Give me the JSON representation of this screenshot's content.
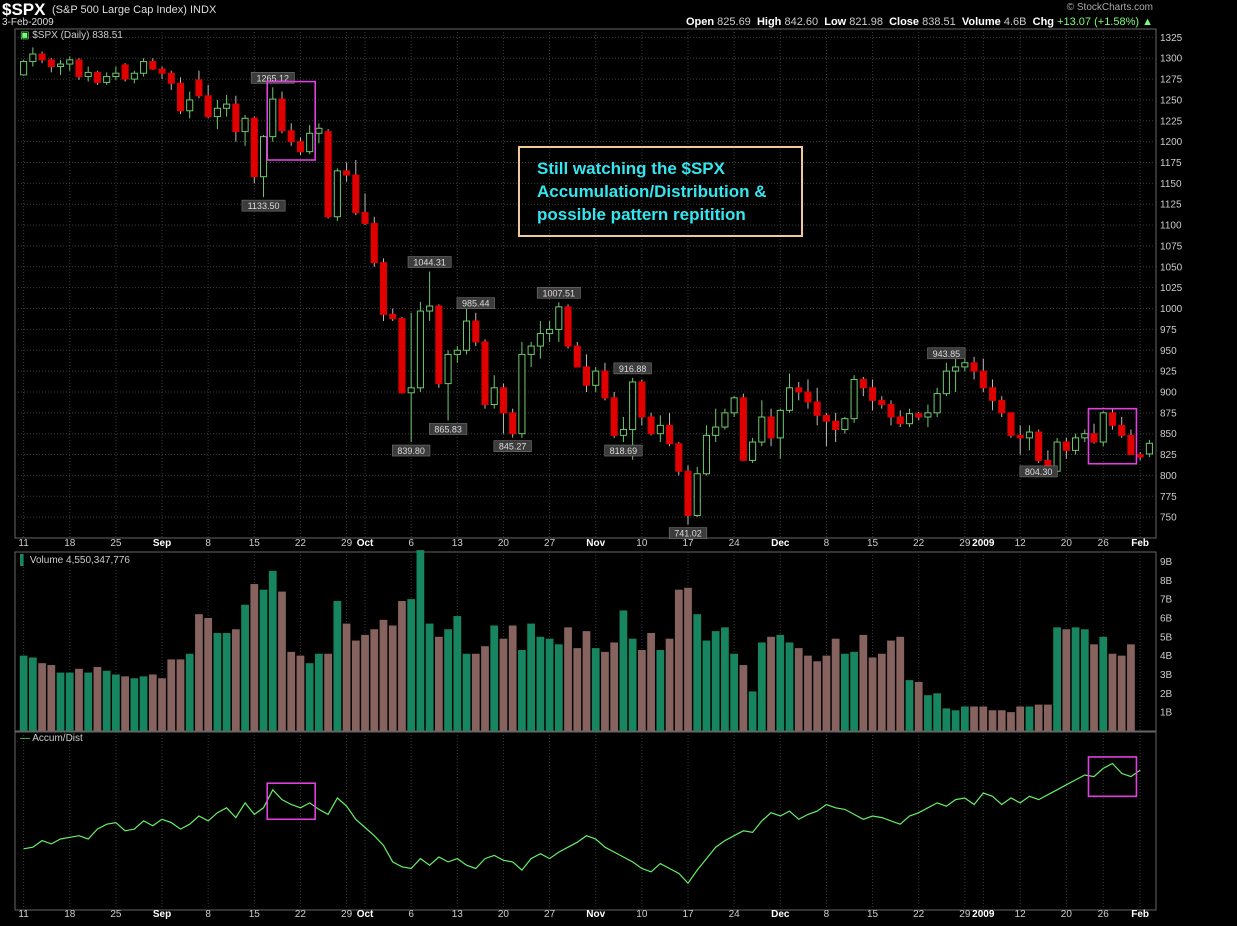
{
  "header": {
    "symbol": "$SPX",
    "name": "(S&P 500 Large Cap Index) INDX",
    "date": "3-Feb-2009",
    "brand": "© StockCharts.com",
    "open_label": "Open",
    "open": "825.69",
    "high_label": "High",
    "high": "842.60",
    "low_label": "Low",
    "low": "821.98",
    "close_label": "Close",
    "close": "838.51",
    "volume_label": "Volume",
    "volume": "4.6B",
    "chg_label": "Chg",
    "chg": "+13.07 (+1.58%)"
  },
  "price_label": "$SPX (Daily) 838.51",
  "volume_label": "Volume 4,550,347,776",
  "ad_label": "Accum/Dist",
  "annotation": "Still watching the $SPX\nAccumulation/Distribution &\npossible pattern repitition",
  "colors": {
    "up": "#6ec96e",
    "down": "#e00000",
    "vol_up": "#178560",
    "vol_down": "#87635f",
    "ad": "#66ee66",
    "box": "#e040e0",
    "note": "#33e6f0"
  },
  "chart_data": {
    "type": "candlestick",
    "price_axis": {
      "ticks": [
        750,
        775,
        800,
        825,
        850,
        875,
        900,
        925,
        950,
        975,
        1000,
        1025,
        1050,
        1075,
        1100,
        1125,
        1150,
        1175,
        1200,
        1225,
        1250,
        1275,
        1300,
        1325
      ],
      "range": [
        725,
        1335
      ]
    },
    "x_tick_labels": [
      "11",
      "18",
      "25",
      "Sep",
      "8",
      "15",
      "22",
      "29",
      "Oct",
      "6",
      "13",
      "20",
      "27",
      "Nov",
      "10",
      "17",
      "24",
      "Dec",
      "8",
      "15",
      "22",
      "29",
      "2009",
      "12",
      "20",
      "26",
      "Feb"
    ],
    "x_tick_index": [
      0,
      5,
      10,
      15,
      20,
      25,
      30,
      35,
      37,
      42,
      47,
      52,
      57,
      62,
      67,
      72,
      77,
      82,
      87,
      92,
      97,
      102,
      104,
      108,
      113,
      117,
      121
    ],
    "bold_ticks": [
      "Sep",
      "Oct",
      "Nov",
      "Dec",
      "2009",
      "Feb"
    ],
    "ohlc": [
      [
        1280,
        1298,
        1279,
        1296
      ],
      [
        1296,
        1313,
        1290,
        1305
      ],
      [
        1305,
        1308,
        1294,
        1298
      ],
      [
        1298,
        1300,
        1283,
        1290
      ],
      [
        1290,
        1298,
        1280,
        1293
      ],
      [
        1293,
        1302,
        1285,
        1298
      ],
      [
        1298,
        1300,
        1274,
        1278
      ],
      [
        1278,
        1290,
        1272,
        1283
      ],
      [
        1283,
        1285,
        1268,
        1271
      ],
      [
        1271,
        1283,
        1268,
        1278
      ],
      [
        1278,
        1290,
        1274,
        1282
      ],
      [
        1292,
        1294,
        1272,
        1275
      ],
      [
        1275,
        1285,
        1270,
        1282
      ],
      [
        1282,
        1300,
        1278,
        1296
      ],
      [
        1296,
        1300,
        1286,
        1287
      ],
      [
        1287,
        1290,
        1275,
        1282
      ],
      [
        1282,
        1285,
        1262,
        1270
      ],
      [
        1270,
        1277,
        1233,
        1237
      ],
      [
        1237,
        1260,
        1228,
        1250
      ],
      [
        1274,
        1285,
        1252,
        1255
      ],
      [
        1255,
        1268,
        1228,
        1230
      ],
      [
        1230,
        1250,
        1215,
        1240
      ],
      [
        1240,
        1256,
        1230,
        1245
      ],
      [
        1245,
        1255,
        1200,
        1212
      ],
      [
        1212,
        1232,
        1195,
        1228
      ],
      [
        1228,
        1230,
        1150,
        1158
      ],
      [
        1158,
        1208,
        1133.5,
        1206
      ],
      [
        1206,
        1265.12,
        1200,
        1251
      ],
      [
        1251,
        1260,
        1210,
        1213
      ],
      [
        1213,
        1222,
        1195,
        1200
      ],
      [
        1200,
        1205,
        1184,
        1188
      ],
      [
        1188,
        1220,
        1185,
        1210
      ],
      [
        1210,
        1222,
        1198,
        1216
      ],
      [
        1212,
        1215,
        1108,
        1110
      ],
      [
        1110,
        1168,
        1105,
        1165
      ],
      [
        1165,
        1175,
        1152,
        1160
      ],
      [
        1160,
        1178,
        1112,
        1115
      ],
      [
        1115,
        1138,
        1100,
        1102
      ],
      [
        1102,
        1110,
        1050,
        1055
      ],
      [
        1055,
        1060,
        985,
        993
      ],
      [
        993,
        1000,
        985,
        988
      ],
      [
        988,
        990,
        898,
        899
      ],
      [
        899,
        995,
        840,
        905
      ],
      [
        905,
        1008,
        900,
        997
      ],
      [
        997,
        1044.31,
        985,
        1003
      ],
      [
        1003,
        1005,
        905,
        910
      ],
      [
        910,
        950,
        865.83,
        945
      ],
      [
        945,
        955,
        935,
        950
      ],
      [
        950,
        1002,
        945,
        985
      ],
      [
        985,
        995,
        955,
        960
      ],
      [
        960,
        963,
        880,
        885
      ],
      [
        885,
        920,
        880,
        905
      ],
      [
        905,
        910,
        850,
        875
      ],
      [
        875,
        880,
        845.27,
        850
      ],
      [
        850,
        960,
        845,
        945
      ],
      [
        945,
        960,
        930,
        955
      ],
      [
        955,
        985,
        940,
        970
      ],
      [
        970,
        985,
        960,
        975
      ],
      [
        975,
        1007.51,
        960,
        1002
      ],
      [
        1002,
        1005,
        952,
        955
      ],
      [
        955,
        960,
        930,
        930
      ],
      [
        930,
        945,
        900,
        908
      ],
      [
        908,
        930,
        900,
        925
      ],
      [
        925,
        935,
        890,
        893
      ],
      [
        893,
        900,
        845,
        848
      ],
      [
        848,
        870,
        840,
        855
      ],
      [
        855,
        916.88,
        818.69,
        912
      ],
      [
        912,
        915,
        860,
        870
      ],
      [
        870,
        875,
        848,
        850
      ],
      [
        850,
        872,
        840,
        860
      ],
      [
        860,
        875,
        835,
        838
      ],
      [
        838,
        840,
        800,
        805
      ],
      [
        805,
        812,
        741.02,
        752
      ],
      [
        752,
        810,
        750,
        802
      ],
      [
        802,
        860,
        800,
        848
      ],
      [
        848,
        880,
        840,
        858
      ],
      [
        858,
        880,
        855,
        875
      ],
      [
        875,
        895,
        870,
        893
      ],
      [
        893,
        898,
        818,
        818
      ],
      [
        818,
        845,
        815,
        840
      ],
      [
        840,
        890,
        835,
        870
      ],
      [
        870,
        880,
        835,
        845
      ],
      [
        845,
        880,
        820,
        878
      ],
      [
        878,
        922,
        875,
        905
      ],
      [
        905,
        912,
        890,
        900
      ],
      [
        900,
        915,
        880,
        888
      ],
      [
        888,
        905,
        860,
        872
      ],
      [
        872,
        875,
        835,
        865
      ],
      [
        865,
        875,
        840,
        855
      ],
      [
        855,
        870,
        850,
        868
      ],
      [
        868,
        920,
        863,
        915
      ],
      [
        915,
        918,
        895,
        905
      ],
      [
        905,
        915,
        878,
        890
      ],
      [
        890,
        895,
        880,
        885
      ],
      [
        885,
        890,
        860,
        870
      ],
      [
        870,
        878,
        858,
        862
      ],
      [
        862,
        880,
        858,
        874
      ],
      [
        874,
        876,
        866,
        870
      ],
      [
        870,
        885,
        858,
        875
      ],
      [
        875,
        905,
        870,
        898
      ],
      [
        898,
        935,
        895,
        925
      ],
      [
        925,
        940,
        900,
        930
      ],
      [
        930,
        943.85,
        925,
        935
      ],
      [
        935,
        942,
        915,
        925
      ],
      [
        925,
        940,
        900,
        905
      ],
      [
        905,
        915,
        878,
        890
      ],
      [
        890,
        895,
        870,
        875
      ],
      [
        875,
        875,
        845,
        848
      ],
      [
        848,
        860,
        825,
        845
      ],
      [
        845,
        860,
        830,
        852
      ],
      [
        852,
        855,
        815,
        818
      ],
      [
        818,
        830,
        800,
        805
      ],
      [
        805,
        845,
        804.3,
        840
      ],
      [
        840,
        845,
        820,
        830
      ],
      [
        830,
        850,
        825,
        845
      ],
      [
        845,
        855,
        840,
        850
      ],
      [
        850,
        862,
        838,
        840
      ],
      [
        840,
        877,
        835,
        875
      ],
      [
        875,
        880,
        855,
        860
      ],
      [
        860,
        870,
        845,
        848
      ],
      [
        848,
        855,
        825,
        825
      ],
      [
        825,
        828,
        818,
        822
      ],
      [
        825.69,
        842.6,
        821.98,
        838.51
      ]
    ],
    "price_labels": [
      {
        "i": 27,
        "text": "1265.12",
        "pos": "above"
      },
      {
        "i": 26,
        "text": "1133.50",
        "pos": "below"
      },
      {
        "i": 44,
        "text": "1044.31",
        "pos": "above"
      },
      {
        "i": 42,
        "text": "839.80",
        "pos": "below"
      },
      {
        "i": 49,
        "text": "985.44",
        "pos": "above"
      },
      {
        "i": 46,
        "text": "865.83",
        "pos": "below"
      },
      {
        "i": 53,
        "text": "845.27",
        "pos": "below"
      },
      {
        "i": 58,
        "text": "1007.51",
        "pos": "above"
      },
      {
        "i": 66,
        "text": "916.88",
        "pos": "above"
      },
      {
        "i": 65,
        "text": "818.69",
        "pos": "below"
      },
      {
        "i": 72,
        "text": "741.02",
        "pos": "below"
      },
      {
        "i": 100,
        "text": "943.85",
        "pos": "above"
      },
      {
        "i": 110,
        "text": "804.30",
        "pos": "below"
      }
    ],
    "volume_axis": {
      "ticks": [
        "1B",
        "2B",
        "3B",
        "4B",
        "5B",
        "6B",
        "7B",
        "8B",
        "9B"
      ],
      "range": [
        0,
        9.5
      ]
    },
    "volume": [
      4.0,
      3.9,
      3.6,
      3.5,
      3.1,
      3.1,
      3.3,
      3.1,
      3.4,
      3.2,
      3.0,
      2.9,
      2.8,
      2.9,
      3.0,
      2.8,
      3.8,
      3.8,
      4.1,
      6.2,
      6.0,
      5.2,
      5.2,
      5.4,
      6.7,
      7.8,
      7.5,
      8.5,
      7.4,
      4.2,
      4.0,
      3.6,
      4.1,
      4.1,
      6.9,
      5.7,
      4.8,
      5.1,
      5.4,
      5.9,
      5.6,
      6.9,
      7.0,
      9.6,
      5.7,
      5.0,
      5.4,
      6.1,
      4.1,
      4.1,
      4.5,
      5.6,
      4.9,
      5.6,
      4.3,
      5.7,
      5.0,
      4.9,
      4.6,
      5.5,
      4.4,
      5.3,
      4.4,
      4.2,
      4.7,
      6.4,
      4.9,
      4.3,
      5.2,
      4.3,
      4.9,
      7.5,
      7.6,
      6.2,
      4.8,
      5.3,
      5.5,
      4.1,
      3.5,
      2.1,
      4.7,
      5.0,
      5.1,
      4.7,
      4.4,
      4.0,
      3.7,
      4.0,
      4.9,
      4.1,
      4.2,
      5.1,
      3.9,
      4.1,
      4.8,
      5.0,
      2.7,
      2.6,
      1.9,
      2.0,
      1.2,
      1.1,
      1.3,
      1.3,
      1.3,
      1.1,
      1.1,
      1.0,
      1.3,
      1.3,
      1.4,
      1.4,
      5.5,
      5.4,
      5.5,
      5.4,
      4.6,
      5.0,
      4.1,
      4.0,
      4.6
    ],
    "ad": [
      30,
      31,
      35,
      33,
      36,
      37,
      38,
      36,
      42,
      45,
      46,
      41,
      42,
      47,
      44,
      48,
      46,
      42,
      45,
      50,
      47,
      52,
      55,
      49,
      58,
      51,
      55,
      66,
      60,
      57,
      55,
      58,
      54,
      51,
      61,
      56,
      48,
      43,
      38,
      32,
      22,
      19,
      18,
      24,
      20,
      25,
      22,
      24,
      20,
      18,
      24,
      26,
      23,
      22,
      17,
      24,
      27,
      24,
      28,
      31,
      34,
      38,
      36,
      31,
      28,
      25,
      22,
      18,
      16,
      21,
      18,
      15,
      9,
      17,
      24,
      31,
      35,
      38,
      41,
      40,
      47,
      52,
      50,
      53,
      48,
      51,
      53,
      57,
      55,
      54,
      51,
      48,
      50,
      49,
      47,
      45,
      50,
      52,
      55,
      58,
      56,
      60,
      61,
      57,
      64,
      62,
      57,
      61,
      58,
      62,
      60,
      63,
      66,
      69,
      72,
      75,
      74,
      79,
      82,
      76,
      74,
      78
    ],
    "ad_labels": []
  },
  "boxes": [
    {
      "panel": "price",
      "i0": 27,
      "i1": 31,
      "v0": 1178,
      "v1": 1272
    },
    {
      "panel": "price",
      "i0": 116,
      "i1": 120,
      "v0": 814,
      "v1": 880
    },
    {
      "panel": "ad",
      "i0": 27,
      "i1": 31,
      "v0": 48,
      "v1": 70
    },
    {
      "panel": "ad",
      "i0": 116,
      "i1": 120,
      "v0": 62,
      "v1": 86
    }
  ]
}
